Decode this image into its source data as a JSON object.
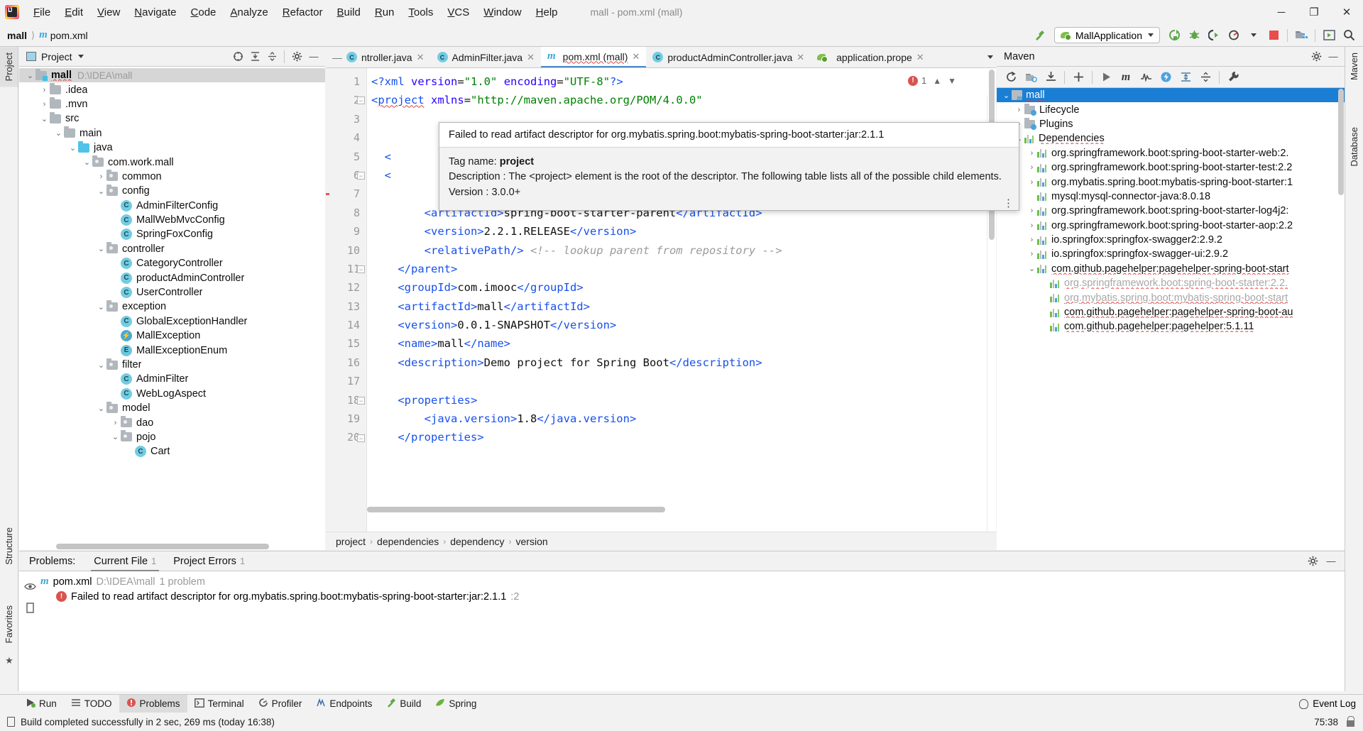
{
  "window": {
    "title": "mall - pom.xml (mall)",
    "minimize": "─",
    "maximize": "❐",
    "close": "✕"
  },
  "menu": [
    {
      "label": "File"
    },
    {
      "label": "Edit"
    },
    {
      "label": "View"
    },
    {
      "label": "Navigate"
    },
    {
      "label": "Code"
    },
    {
      "label": "Analyze"
    },
    {
      "label": "Refactor"
    },
    {
      "label": "Build"
    },
    {
      "label": "Run"
    },
    {
      "label": "Tools"
    },
    {
      "label": "VCS"
    },
    {
      "label": "Window"
    },
    {
      "label": "Help"
    }
  ],
  "navbar": {
    "crumb_project": "mall",
    "crumb_file": "pom.xml",
    "run_config": "MallApplication",
    "icons": [
      "hammer-build-icon",
      "run-icon",
      "debug-icon",
      "run-with-coverage-icon",
      "profile-icon",
      "stop-icon",
      "project-structure-icon",
      "select-in-icon",
      "search-everywhere-icon"
    ]
  },
  "left_strip": {
    "project_tab": "Project",
    "structure_tab": "Structure",
    "favorites_tab": "Favorites"
  },
  "right_strip": {
    "maven_tab": "Maven",
    "database_tab": "Database"
  },
  "project_panel": {
    "title": "Project",
    "tree": [
      {
        "depth": 0,
        "arrow": "⌄",
        "icon": "module-folder",
        "label": "mall",
        "bold": true,
        "path": "D:\\IDEA\\mall",
        "selected": true,
        "squiggle": true
      },
      {
        "depth": 1,
        "arrow": "›",
        "icon": "folder",
        "label": ".idea"
      },
      {
        "depth": 1,
        "arrow": "›",
        "icon": "folder",
        "label": ".mvn"
      },
      {
        "depth": 1,
        "arrow": "⌄",
        "icon": "folder",
        "label": "src"
      },
      {
        "depth": 2,
        "arrow": "⌄",
        "icon": "folder",
        "label": "main"
      },
      {
        "depth": 3,
        "arrow": "⌄",
        "icon": "source-folder",
        "label": "java"
      },
      {
        "depth": 4,
        "arrow": "⌄",
        "icon": "package",
        "label": "com.work.mall"
      },
      {
        "depth": 5,
        "arrow": "›",
        "icon": "package",
        "label": "common"
      },
      {
        "depth": 5,
        "arrow": "⌄",
        "icon": "package",
        "label": "config"
      },
      {
        "depth": 6,
        "arrow": "",
        "icon": "class",
        "label": "AdminFilterConfig"
      },
      {
        "depth": 6,
        "arrow": "",
        "icon": "class",
        "label": "MallWebMvcConfig"
      },
      {
        "depth": 6,
        "arrow": "",
        "icon": "class",
        "label": "SpringFoxConfig"
      },
      {
        "depth": 5,
        "arrow": "⌄",
        "icon": "package",
        "label": "controller"
      },
      {
        "depth": 6,
        "arrow": "",
        "icon": "class",
        "label": "CategoryController"
      },
      {
        "depth": 6,
        "arrow": "",
        "icon": "class",
        "label": "productAdminController"
      },
      {
        "depth": 6,
        "arrow": "",
        "icon": "class",
        "label": "UserController"
      },
      {
        "depth": 5,
        "arrow": "⌄",
        "icon": "package",
        "label": "exception"
      },
      {
        "depth": 6,
        "arrow": "",
        "icon": "class",
        "label": "GlobalExceptionHandler"
      },
      {
        "depth": 6,
        "arrow": "",
        "icon": "exception-class",
        "label": "MallException"
      },
      {
        "depth": 6,
        "arrow": "",
        "icon": "enum",
        "label": "MallExceptionEnum"
      },
      {
        "depth": 5,
        "arrow": "⌄",
        "icon": "package",
        "label": "filter"
      },
      {
        "depth": 6,
        "arrow": "",
        "icon": "class",
        "label": "AdminFilter"
      },
      {
        "depth": 6,
        "arrow": "",
        "icon": "class",
        "label": "WebLogAspect"
      },
      {
        "depth": 5,
        "arrow": "⌄",
        "icon": "package",
        "label": "model"
      },
      {
        "depth": 6,
        "arrow": "›",
        "icon": "package",
        "label": "dao"
      },
      {
        "depth": 6,
        "arrow": "⌄",
        "icon": "package",
        "label": "pojo"
      },
      {
        "depth": 7,
        "arrow": "",
        "icon": "class",
        "label": "Cart"
      }
    ]
  },
  "editor": {
    "tabs": [
      {
        "label": "ntroller.java",
        "icon": "java-class-icon",
        "active": false,
        "truncated": true
      },
      {
        "label": "AdminFilter.java",
        "icon": "java-class-icon",
        "active": false
      },
      {
        "label": "pom.xml (mall)",
        "icon": "maven-icon",
        "active": true
      },
      {
        "label": "productAdminController.java",
        "icon": "java-class-icon",
        "active": false
      },
      {
        "label": "application.prope",
        "icon": "spring-icon",
        "active": false
      }
    ],
    "error_count": "1",
    "lines": [
      {
        "n": "1",
        "html": "<span class=\"tg\">&lt;?xml</span> <span class=\"at\">version</span><span class=\"txt\">=</span><span class=\"av\">\"1.0\"</span> <span class=\"at\">encoding</span><span class=\"txt\">=</span><span class=\"av\">\"UTF-8\"</span><span class=\"tg\">?&gt;</span>"
      },
      {
        "n": "2",
        "html": "<span class=\"tg\">&lt;<span class=\"err-squig\">project</span></span> <span class=\"at\">xmlns</span><span class=\"txt\">=</span><span class=\"av\">\"http://maven.apache.org/POM/4.0.0\"</span>",
        "fold": true
      },
      {
        "n": "3",
        "html": ""
      },
      {
        "n": "4",
        "html": ""
      },
      {
        "n": "5",
        "html": "  <span class=\"tg\">&lt;</span>"
      },
      {
        "n": "6",
        "html": "  <span class=\"tg\">&lt;</span>",
        "fold": true
      },
      {
        "n": "7",
        "html": ""
      },
      {
        "n": "8",
        "html": "        <span class=\"tg\">&lt;artifactId&gt;</span><span class=\"txt\">spring-boot-starter-parent</span><span class=\"tg\">&lt;/artifactId&gt;</span>"
      },
      {
        "n": "9",
        "html": "        <span class=\"tg\">&lt;version&gt;</span><span class=\"txt\">2.2.1.RELEASE</span><span class=\"tg\">&lt;/version&gt;</span>"
      },
      {
        "n": "10",
        "html": "        <span class=\"tg\">&lt;relativePath/&gt;</span> <span class=\"cm\">&lt;!-- lookup parent from repository --&gt;</span>"
      },
      {
        "n": "11",
        "html": "    <span class=\"tg\">&lt;/parent&gt;</span>",
        "fold": true
      },
      {
        "n": "12",
        "html": "    <span class=\"tg\">&lt;groupId&gt;</span><span class=\"txt\">com.imooc</span><span class=\"tg\">&lt;/groupId&gt;</span>"
      },
      {
        "n": "13",
        "html": "    <span class=\"tg\">&lt;artifactId&gt;</span><span class=\"txt\">mall</span><span class=\"tg\">&lt;/artifactId&gt;</span>"
      },
      {
        "n": "14",
        "html": "    <span class=\"tg\">&lt;version&gt;</span><span class=\"txt\">0.0.1-SNAPSHOT</span><span class=\"tg\">&lt;/version&gt;</span>"
      },
      {
        "n": "15",
        "html": "    <span class=\"tg\">&lt;name&gt;</span><span class=\"txt\">mall</span><span class=\"tg\">&lt;/name&gt;</span>"
      },
      {
        "n": "16",
        "html": "    <span class=\"tg\">&lt;description&gt;</span><span class=\"txt\">Demo project for Spring Boot</span><span class=\"tg\">&lt;/description&gt;</span>"
      },
      {
        "n": "17",
        "html": ""
      },
      {
        "n": "18",
        "html": "    <span class=\"tg\">&lt;properties&gt;</span>",
        "fold": true
      },
      {
        "n": "19",
        "html": "        <span class=\"tg\">&lt;java.version&gt;</span><span class=\"txt\">1.8</span><span class=\"tg\">&lt;/java.version&gt;</span>"
      },
      {
        "n": "20",
        "html": "    <span class=\"tg\">&lt;/properties&gt;</span>",
        "fold": true
      }
    ],
    "breadcrumbs": [
      "project",
      "dependencies",
      "dependency",
      "version"
    ]
  },
  "tooltip": {
    "error": "Failed to read artifact descriptor for org.mybatis.spring.boot:mybatis-spring-boot-starter:jar:2.1.1",
    "tag_label": "Tag name:",
    "tag_value": "project",
    "description": "Description : The <project> element is the root of the descriptor. The following table lists all of the possible child elements.",
    "version": "Version : 3.0.0+"
  },
  "maven_panel": {
    "title": "Maven",
    "toolbar_icons": [
      "reimport-icon",
      "generate-sources-icon",
      "download-sources-icon",
      "add-icon",
      "run-icon",
      "maven-goal-icon",
      "toggle-skip-tests-icon",
      "execute-maven-goal-icon",
      "expand-all-icon",
      "collapse-all-icon",
      "settings-wrench-icon"
    ],
    "tree": [
      {
        "depth": 0,
        "arrow": "⌄",
        "icon": "maven-module",
        "label": "mall",
        "selected": true,
        "squiggle": true
      },
      {
        "depth": 1,
        "arrow": "›",
        "icon": "lifecycle-folder",
        "label": "Lifecycle"
      },
      {
        "depth": 1,
        "arrow": "›",
        "icon": "plugins-folder",
        "label": "Plugins"
      },
      {
        "depth": 1,
        "arrow": "⌄",
        "icon": "dependencies-folder",
        "label": "Dependencies",
        "squiggle": true
      },
      {
        "depth": 2,
        "arrow": "›",
        "icon": "dependency",
        "label": "org.springframework.boot:spring-boot-starter-web:2."
      },
      {
        "depth": 2,
        "arrow": "›",
        "icon": "dependency",
        "label": "org.springframework.boot:spring-boot-starter-test:2.2"
      },
      {
        "depth": 2,
        "arrow": "›",
        "icon": "dependency",
        "label": "org.mybatis.spring.boot:mybatis-spring-boot-starter:1"
      },
      {
        "depth": 2,
        "arrow": "",
        "icon": "dependency",
        "label": "mysql:mysql-connector-java:8.0.18"
      },
      {
        "depth": 2,
        "arrow": "›",
        "icon": "dependency",
        "label": "org.springframework.boot:spring-boot-starter-log4j2:"
      },
      {
        "depth": 2,
        "arrow": "›",
        "icon": "dependency",
        "label": "org.springframework.boot:spring-boot-starter-aop:2.2"
      },
      {
        "depth": 2,
        "arrow": "›",
        "icon": "dependency",
        "label": "io.springfox:springfox-swagger2:2.9.2"
      },
      {
        "depth": 2,
        "arrow": "›",
        "icon": "dependency",
        "label": "io.springfox:springfox-swagger-ui:2.9.2"
      },
      {
        "depth": 2,
        "arrow": "⌄",
        "icon": "dependency",
        "label": "com.github.pagehelper:pagehelper-spring-boot-start",
        "squiggle": true
      },
      {
        "depth": 3,
        "arrow": "",
        "icon": "dependency",
        "label": "org.springframework.boot:spring-boot-starter:2.2.",
        "dim": true,
        "squiggle": true
      },
      {
        "depth": 3,
        "arrow": "",
        "icon": "dependency",
        "label": "org.mybatis.spring.boot:mybatis-spring-boot-start",
        "dim": true,
        "squiggle": true
      },
      {
        "depth": 3,
        "arrow": "",
        "icon": "dependency",
        "label": "com.github.pagehelper:pagehelper-spring-boot-au",
        "squiggle": true
      },
      {
        "depth": 3,
        "arrow": "",
        "icon": "dependency",
        "label": "com.github.pagehelper:pagehelper:5.1.11",
        "squiggle": true
      }
    ]
  },
  "problems_panel": {
    "label": "Problems:",
    "tabs": [
      {
        "label": "Current File",
        "count": "1",
        "active": true
      },
      {
        "label": "Project Errors",
        "count": "1",
        "active": false
      }
    ],
    "file_name": "pom.xml",
    "file_path": "D:\\IDEA\\mall",
    "file_count": "1 problem",
    "items": [
      {
        "text": "Failed to read artifact descriptor for org.mybatis.spring.boot:mybatis-spring-boot-starter:jar:2.1.1",
        "loc": ":2"
      }
    ]
  },
  "bottom_strip": {
    "items": [
      {
        "label": "Run",
        "icon": "run-icon",
        "active": false
      },
      {
        "label": "TODO",
        "icon": "todo-icon",
        "active": false
      },
      {
        "label": "Problems",
        "icon": "problems-error-icon",
        "active": true
      },
      {
        "label": "Terminal",
        "icon": "terminal-icon",
        "active": false
      },
      {
        "label": "Profiler",
        "icon": "profiler-icon",
        "active": false
      },
      {
        "label": "Endpoints",
        "icon": "endpoints-icon",
        "active": false
      },
      {
        "label": "Build",
        "icon": "build-hammer-icon",
        "active": false
      },
      {
        "label": "Spring",
        "icon": "spring-leaf-icon",
        "active": false
      }
    ],
    "event_log": "Event Log"
  },
  "status_bar": {
    "message": "Build completed successfully in 2 sec, 269 ms (today 16:38)",
    "caret_position": "75:38"
  },
  "colors": {
    "accent_blue": "#1a7fd4",
    "error_red": "#d9534f",
    "tag_blue": "#1750eb",
    "string_green": "#008000",
    "selection_grey": "#d6d6d6"
  }
}
